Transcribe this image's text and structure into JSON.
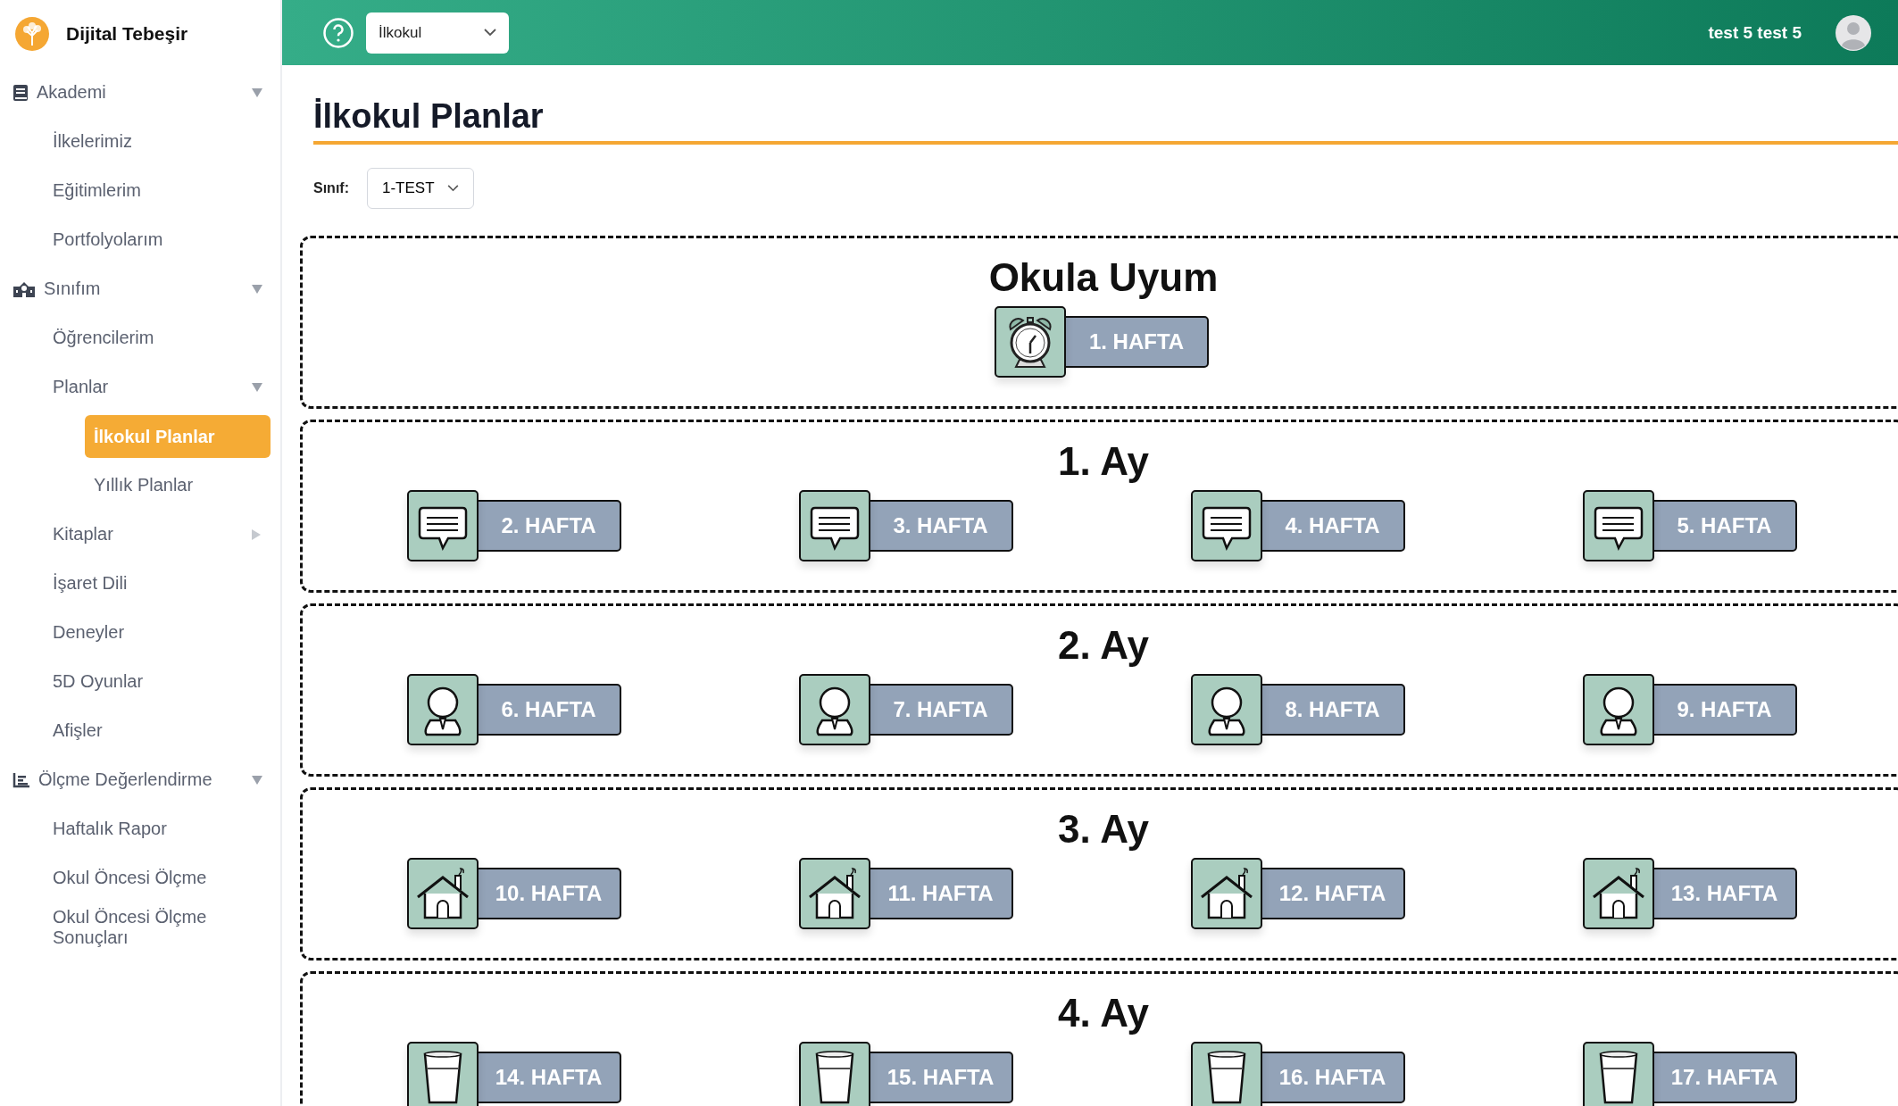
{
  "brand": {
    "name": "Dijital Tebeşir"
  },
  "header": {
    "level_select": {
      "value": "İlkokul"
    },
    "user_name": "test 5 test 5"
  },
  "sidebar": {
    "items": [
      {
        "label": "Akademi",
        "expanded": true,
        "selected": false,
        "children": [
          {
            "label": "İlkelerimiz",
            "selected": false
          },
          {
            "label": "Eğitimlerim",
            "selected": false
          },
          {
            "label": "Portfolyolarım",
            "selected": false
          }
        ]
      },
      {
        "label": "Sınıfım",
        "expanded": true,
        "selected": false,
        "children": [
          {
            "label": "Öğrencilerim",
            "selected": false
          },
          {
            "label": "Planlar",
            "expanded": true,
            "selected": false,
            "children": [
              {
                "label": "İlkokul Planlar",
                "selected": true
              },
              {
                "label": "Yıllık Planlar",
                "selected": false
              }
            ]
          },
          {
            "label": "Kitaplar",
            "expanded": false,
            "selected": false
          },
          {
            "label": "İşaret Dili",
            "selected": false
          },
          {
            "label": "Deneyler",
            "selected": false
          },
          {
            "label": "5D Oyunlar",
            "selected": false
          },
          {
            "label": "Afişler",
            "selected": false
          }
        ]
      },
      {
        "label": "Ölçme Değerlendirme",
        "expanded": true,
        "selected": false,
        "children": [
          {
            "label": "Haftalık Rapor",
            "selected": false
          },
          {
            "label": "Okul Öncesi Ölçme",
            "selected": false
          },
          {
            "label": "Okul Öncesi Ölçme Sonuçları",
            "selected": false
          }
        ]
      }
    ]
  },
  "page": {
    "title": "İlkokul Planlar",
    "class_filter": {
      "label": "Sınıf:",
      "value": "1-TEST"
    }
  },
  "sections": [
    {
      "title": "Okula Uyum",
      "weeks": [
        "1. HAFTA"
      ]
    },
    {
      "title": "1. Ay",
      "weeks": [
        "2. HAFTA",
        "3. HAFTA",
        "4. HAFTA",
        "5. HAFTA"
      ]
    },
    {
      "title": "2. Ay",
      "weeks": [
        "6. HAFTA",
        "7. HAFTA",
        "8. HAFTA",
        "9. HAFTA"
      ]
    },
    {
      "title": "3. Ay",
      "weeks": [
        "10. HAFTA",
        "11. HAFTA",
        "12. HAFTA",
        "13. HAFTA"
      ]
    },
    {
      "title": "4. Ay",
      "weeks": [
        "14. HAFTA",
        "15. HAFTA",
        "16. HAFTA",
        "17. HAFTA"
      ]
    }
  ]
}
